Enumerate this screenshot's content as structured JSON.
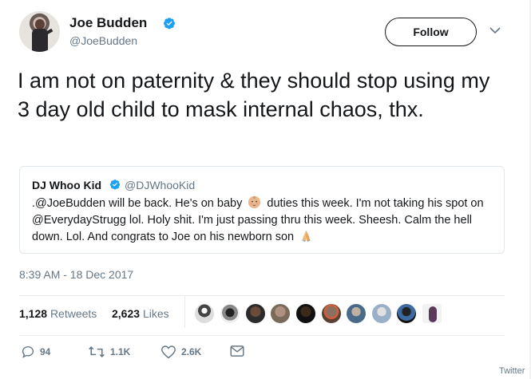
{
  "author": {
    "name": "Joe Budden",
    "handle": "@JoeBudden",
    "verified": true,
    "avatar_icon": "profile-photo-icon"
  },
  "header": {
    "follow_label": "Follow",
    "menu_icon": "chevron-down-icon"
  },
  "tweet": {
    "text": "I am not on paternity & they should stop using my 3 day old child to mask internal chaos, thx.",
    "timestamp": "8:39 AM - 18 Dec 2017"
  },
  "quoted": {
    "name": "DJ Whoo Kid",
    "handle": "@DJWhooKid",
    "verified": true,
    "text_part1": ".@JoeBudden will be back. He's on baby ",
    "emoji1": "baby-face-emoji",
    "text_part2": " duties this week. I'm not taking his spot on @EverydayStrugg lol. Holy shit. I'm just passing thru this week. Sheesh. Calm the hell down. Lol. And congrats to Joe on his newborn son ",
    "emoji2": "folded-hands-emoji"
  },
  "stats": {
    "retweets_count": "1,128",
    "retweets_label": "Retweets",
    "likes_count": "2,623",
    "likes_label": "Likes"
  },
  "likers": [
    "liker-1",
    "liker-2",
    "liker-3",
    "liker-4",
    "liker-5",
    "liker-6",
    "liker-7",
    "liker-8",
    "liker-9",
    "liker-10"
  ],
  "actions": {
    "replies": "94",
    "retweets": "1.1K",
    "likes": "2.6K"
  },
  "footer": {
    "brand": "Twitter"
  },
  "colors": {
    "text": "#14171a",
    "secondary": "#657786",
    "verified": "#1da1f2",
    "border": "#e1e8ed"
  }
}
